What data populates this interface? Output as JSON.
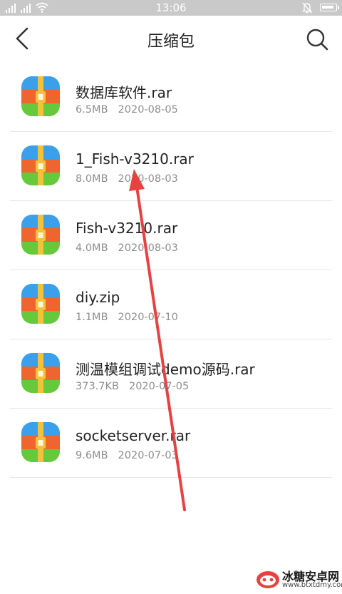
{
  "status_bar": {
    "time": "13:06"
  },
  "header": {
    "title": "压缩包"
  },
  "files": [
    {
      "name": "数据库软件.rar",
      "size": "6.5MB",
      "date": "2020-08-05"
    },
    {
      "name": "1_Fish-v3210.rar",
      "size": "8.0MB",
      "date": "2020-08-03"
    },
    {
      "name": "Fish-v3210.rar",
      "size": "4.0MB",
      "date": "2020-08-03"
    },
    {
      "name": "diy.zip",
      "size": "1.1MB",
      "date": "2020-07-10"
    },
    {
      "name": "测温模组调试demo源码.rar",
      "size": "373.7KB",
      "date": "2020-07-05"
    },
    {
      "name": "socketserver.rar",
      "size": "9.6MB",
      "date": "2020-07-03"
    }
  ],
  "watermark": {
    "name": "冰糖安卓网",
    "url": "www.btxtdmy.com"
  },
  "colors": {
    "status_bar": "#c9c9c9",
    "icon_blue": "#3aa0ec",
    "icon_orange": "#f0642d",
    "icon_green": "#66c93c",
    "icon_zipper": "#f3c23a",
    "annotation_arrow": "#e8413f"
  }
}
